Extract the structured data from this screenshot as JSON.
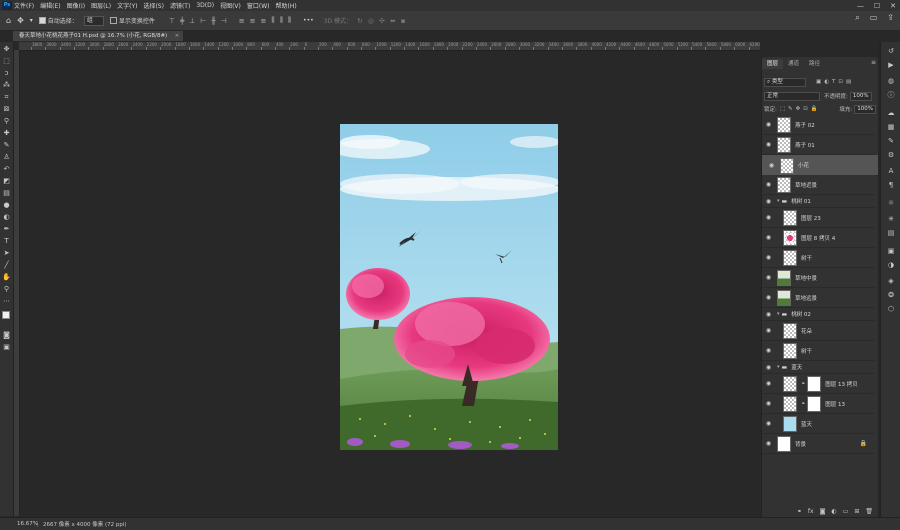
{
  "app": {
    "logo": "Ps"
  },
  "menu": [
    "文件(F)",
    "编辑(E)",
    "图像(I)",
    "图层(L)",
    "文字(Y)",
    "选择(S)",
    "滤镜(T)",
    "3D(D)",
    "视图(V)",
    "窗口(W)",
    "帮助(H)"
  ],
  "window_controls": {
    "minimize": "—",
    "maximize": "☐",
    "close": "✕"
  },
  "options": {
    "auto_select_label": "自动选择：",
    "auto_select_value": "组",
    "show_transform_label": "显示变换控件",
    "mode_3d_label": "3D 模式：",
    "more": "•••"
  },
  "document_tab": {
    "title": "春天草地小花桃花燕子01 H.psd @ 16.7% (小花, RGB/8#)",
    "close": "×"
  },
  "ruler_ticks": [
    "3800",
    "3600",
    "3400",
    "3200",
    "3000",
    "2800",
    "2600",
    "2400",
    "2200",
    "2000",
    "1800",
    "1600",
    "1400",
    "1200",
    "1000",
    "800",
    "600",
    "400",
    "200",
    "0",
    "200",
    "400",
    "600",
    "800",
    "1000",
    "1200",
    "1400",
    "1600",
    "1800",
    "2000",
    "2200",
    "2400",
    "2600",
    "2800",
    "3000",
    "3200",
    "3400",
    "3600",
    "3800",
    "4000",
    "4200",
    "4400",
    "4600",
    "4800",
    "5000",
    "5200",
    "5400",
    "5600",
    "5800",
    "6000",
    "6200"
  ],
  "status": {
    "zoom": "16.67%",
    "size": "2667 像素 x 4000 像素 (72 ppi)"
  },
  "panel": {
    "tabs": [
      "图层",
      "通道",
      "路径"
    ],
    "kind_label": "类型",
    "blend_mode": "正常",
    "opacity_label": "不透明度:",
    "opacity_value": "100%",
    "lock_label": "锁定:",
    "fill_label": "填充:",
    "fill_value": "100%",
    "layers": [
      {
        "name": "燕子 02",
        "type": "layer"
      },
      {
        "name": "燕子 01",
        "type": "layer"
      },
      {
        "name": "小花",
        "type": "layer",
        "selected": true
      },
      {
        "name": "草地近景",
        "type": "layer"
      },
      {
        "name": "桃树 01",
        "type": "group"
      },
      {
        "name": "图层 23",
        "type": "layer",
        "indent": true
      },
      {
        "name": "图层 8 拷贝 4",
        "type": "layer",
        "indent": true,
        "thumb": "pink"
      },
      {
        "name": "树干",
        "type": "layer",
        "indent": true
      },
      {
        "name": "草地中景",
        "type": "layer",
        "thumb": "green"
      },
      {
        "name": "草地远景",
        "type": "layer",
        "thumb": "green"
      },
      {
        "name": "桃树 02",
        "type": "group"
      },
      {
        "name": "花朵",
        "type": "layer",
        "indent": true
      },
      {
        "name": "树干",
        "type": "layer",
        "indent": true
      },
      {
        "name": "蓝天",
        "type": "group"
      },
      {
        "name": "图层 13 拷贝",
        "type": "layer",
        "indent": true,
        "mask": true
      },
      {
        "name": "图层 13",
        "type": "layer",
        "indent": true,
        "mask": true
      },
      {
        "name": "蓝天",
        "type": "layer",
        "indent": true,
        "thumb": "sky"
      },
      {
        "name": "背景",
        "type": "background",
        "locked": true
      }
    ]
  },
  "colors": {
    "sky": "#a9dcef",
    "blossom": "#e8397f",
    "grass": "#4f7a3a"
  }
}
